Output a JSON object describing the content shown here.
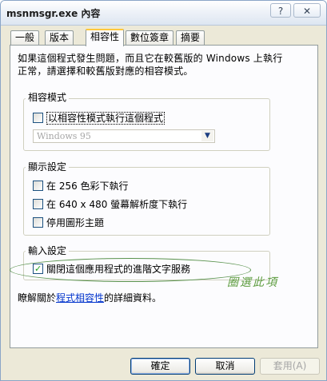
{
  "window": {
    "title": "msnmsgr.exe 內容",
    "help_button": "?",
    "close_button": "✕"
  },
  "tabs": [
    {
      "label": "一般"
    },
    {
      "label": "版本"
    },
    {
      "label": "相容性"
    },
    {
      "label": "數位簽章"
    },
    {
      "label": "摘要"
    }
  ],
  "intro": {
    "line1": "如果這個程式發生問題，而且它在較舊版的 Windows 上執行",
    "line2": "正常，請選擇和較舊版對應的相容模式。"
  },
  "compat_mode": {
    "group_title": "相容模式",
    "checkbox_label": "以相容性模式執行這個程式",
    "checked": false,
    "os_select_value": "Windows 95"
  },
  "display": {
    "group_title": "顯示設定",
    "options": [
      {
        "label": "在 256 色彩下執行",
        "checked": false
      },
      {
        "label": "在 640 x 480 螢幕解析度下執行",
        "checked": false
      },
      {
        "label": "停用圖形主題",
        "checked": false
      }
    ]
  },
  "input": {
    "group_title": "輸入設定",
    "checkbox_label": "關閉這個應用程式的進階文字服務",
    "checked": true
  },
  "annotation": {
    "text": "圈選此項",
    "color": "#5b9b3d"
  },
  "learn_more": {
    "prefix": "瞭解關於",
    "link": "程式相容性",
    "suffix": "的詳細資料。"
  },
  "buttons": {
    "ok": "確定",
    "cancel": "取消",
    "apply": "套用(A)"
  }
}
